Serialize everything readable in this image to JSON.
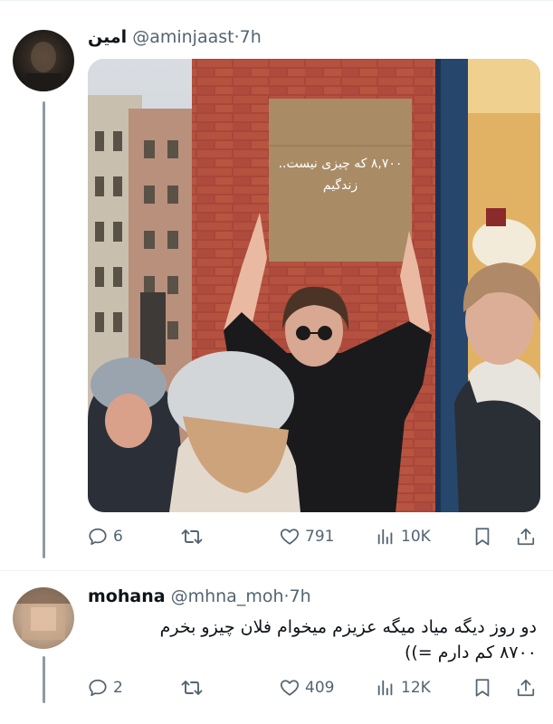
{
  "tweet": {
    "author_name": "امین",
    "handle": "@aminjaast",
    "sep": "·",
    "time": "7h",
    "image": {
      "sign_line1": "۸,۷۰۰ که چیزی نیست..",
      "sign_line2": "زندگیم"
    },
    "actions": {
      "replies": "6",
      "reposts": "",
      "likes": "791",
      "views": "10K"
    }
  },
  "reply": {
    "author_name": "mohana",
    "handle": "@mhna_moh",
    "sep": "·",
    "time": "7h",
    "text_line1": "دو روز دیگه میاد میگه عزیزم میخوام فلان چیزو بخرم",
    "text_line2": "۸۷۰۰ کم دارم =))",
    "actions": {
      "replies": "2",
      "reposts": "",
      "likes": "409",
      "views": "12K"
    }
  },
  "colors": {
    "text": "#0f1419",
    "secondary": "#536471",
    "divider": "#eff3f4",
    "thread_line": "#8e9aa5"
  }
}
